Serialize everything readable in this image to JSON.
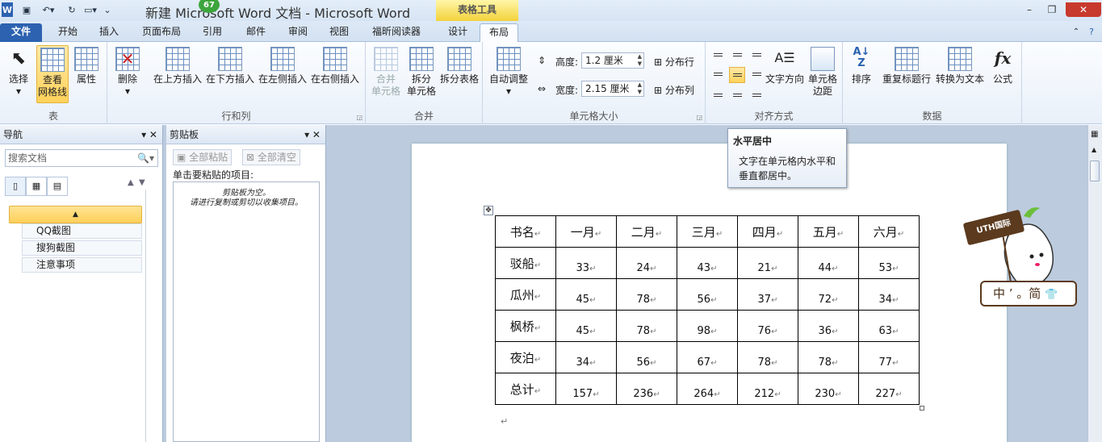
{
  "window": {
    "title": "新建 Microsoft Word 文档 - Microsoft Word",
    "context_tab_group": "表格工具",
    "badge_count": "67"
  },
  "tabs": [
    "文件",
    "开始",
    "插入",
    "页面布局",
    "引用",
    "邮件",
    "审阅",
    "视图",
    "福昕阅读器",
    "设计",
    "布局"
  ],
  "ribbon": {
    "table_group": {
      "label": "表",
      "select": "选择",
      "view_gridlines": "查看\n网格线",
      "properties": "属性"
    },
    "rows_cols_group": {
      "label": "行和列",
      "delete": "删除",
      "insert_above": "在上方插入",
      "insert_below": "在下方插入",
      "insert_left": "在左侧插入",
      "insert_right": "在右侧插入"
    },
    "merge_group": {
      "label": "合并",
      "merge_cells": "合并\n单元格",
      "split_cells": "拆分\n单元格",
      "split_table": "拆分表格"
    },
    "cell_size_group": {
      "label": "单元格大小",
      "autofit": "自动调整",
      "height_label": "高度:",
      "height_value": "1.2 厘米",
      "width_label": "宽度:",
      "width_value": "2.15 厘米",
      "distribute_rows": "分布行",
      "distribute_cols": "分布列"
    },
    "alignment_group": {
      "label": "对齐方式",
      "text_direction": "文字方向",
      "cell_margins": "单元格\n边距"
    },
    "data_group": {
      "label": "数据",
      "sort": "排序",
      "repeat_header": "重复标题行",
      "convert_to_text": "转换为文本",
      "formula": "公式"
    }
  },
  "nav_pane": {
    "title": "导航",
    "search_placeholder": "搜索文档",
    "items": [
      "QQ截图",
      "搜狗截图",
      "注意事项"
    ]
  },
  "clipboard_pane": {
    "title": "剪贴板",
    "paste_all": "全部粘贴",
    "clear_all": "全部清空",
    "instruction": "单击要粘贴的项目:",
    "empty_text": "剪贴板为空。\n请进行复制或剪切以收集项目。"
  },
  "tooltip": {
    "title": "水平居中",
    "body": "文字在单元格内水平和垂直都居中。"
  },
  "ime": {
    "sign": "UTH国际",
    "bar": "中 ’ 。简"
  },
  "document_table": {
    "header": [
      "书名",
      "一月",
      "二月",
      "三月",
      "四月",
      "五月",
      "六月"
    ],
    "rows": [
      [
        "驳船",
        "33",
        "24",
        "43",
        "21",
        "44",
        "53"
      ],
      [
        "瓜州",
        "45",
        "78",
        "56",
        "37",
        "72",
        "34"
      ],
      [
        "枫桥",
        "45",
        "78",
        "98",
        "76",
        "36",
        "63"
      ],
      [
        "夜泊",
        "34",
        "56",
        "67",
        "78",
        "78",
        "77"
      ],
      [
        "总计",
        "157",
        "236",
        "264",
        "212",
        "230",
        "227"
      ]
    ]
  }
}
